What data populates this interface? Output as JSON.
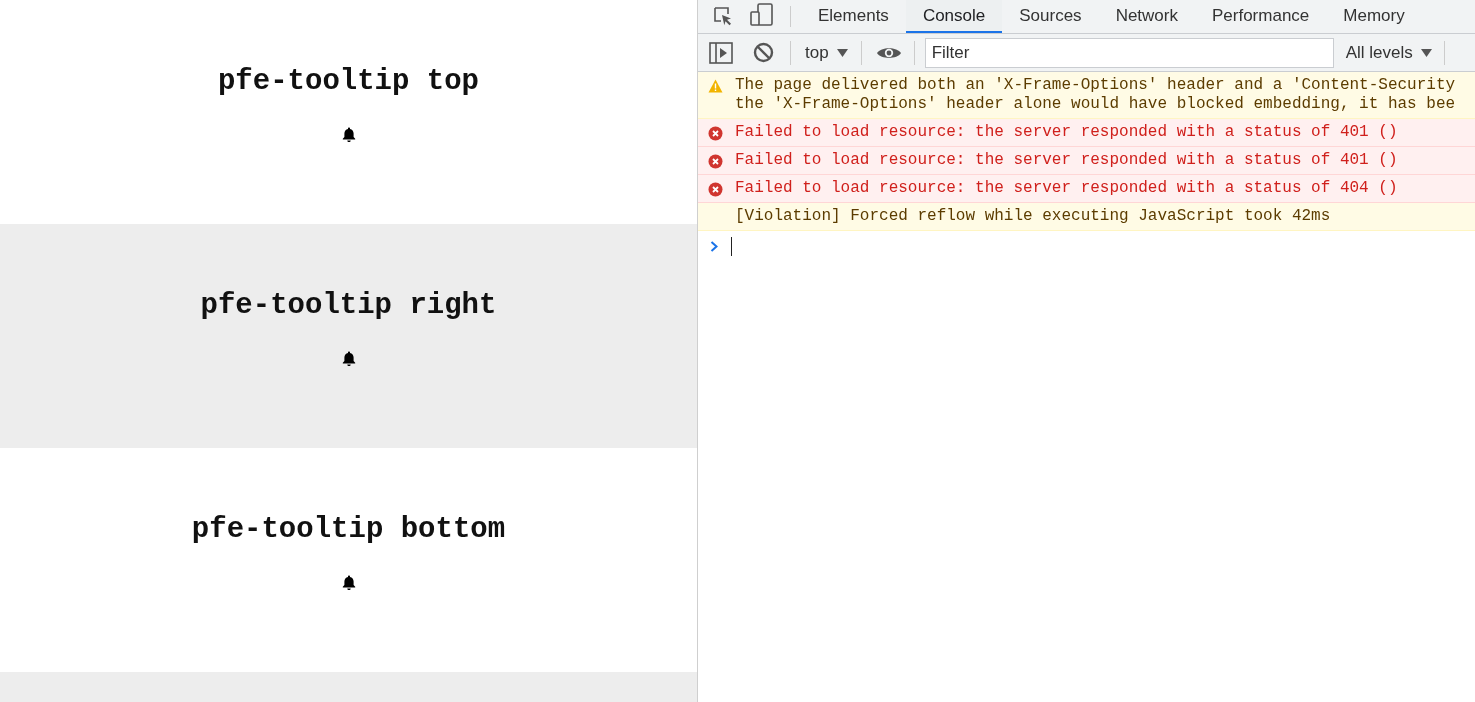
{
  "page_sections": [
    {
      "title": "pfe-tooltip top"
    },
    {
      "title": "pfe-tooltip right"
    },
    {
      "title": "pfe-tooltip bottom"
    }
  ],
  "devtools": {
    "tabs": [
      {
        "label": "Elements",
        "selected": false
      },
      {
        "label": "Console",
        "selected": true
      },
      {
        "label": "Sources",
        "selected": false
      },
      {
        "label": "Network",
        "selected": false
      },
      {
        "label": "Performance",
        "selected": false
      },
      {
        "label": "Memory",
        "selected": false
      }
    ],
    "context": "top",
    "filter": {
      "placeholder": "Filter"
    },
    "levels": "All levels",
    "messages": [
      {
        "kind": "warning",
        "lines": [
          "The page delivered both an 'X-Frame-Options' header and a 'Content-Security",
          "the 'X-Frame-Options' header alone would have blocked embedding, it has bee"
        ]
      },
      {
        "kind": "error",
        "lines": [
          "Failed to load resource: the server responded with a status of 401 ()"
        ]
      },
      {
        "kind": "error",
        "lines": [
          "Failed to load resource: the server responded with a status of 401 ()"
        ]
      },
      {
        "kind": "error",
        "lines": [
          "Failed to load resource: the server responded with a status of 404 ()"
        ]
      },
      {
        "kind": "violation",
        "lines": [
          "[Violation] Forced reflow while executing JavaScript took 42ms"
        ]
      }
    ]
  }
}
